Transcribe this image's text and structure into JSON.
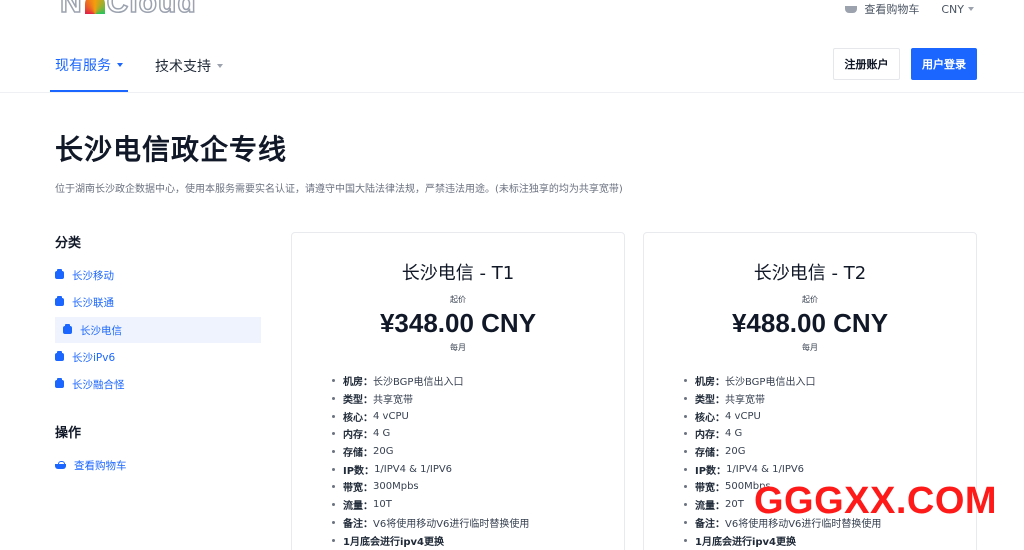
{
  "header": {
    "logo_text_left": "N",
    "logo_text_right": "Cloud",
    "cart_label": "查看购物车",
    "currency": "CNY",
    "nav": [
      {
        "label": "现有服务",
        "active": true
      },
      {
        "label": "技术支持",
        "active": false
      }
    ],
    "register_label": "注册账户",
    "login_label": "用户登录"
  },
  "page": {
    "title": "长沙电信政企专线",
    "description": "位于湖南长沙政企数据中心，使用本服务需要实名认证，请遵守中国大陆法律法规，严禁违法用途。(未标注独享的均为共享宽带)"
  },
  "sidebar": {
    "categories_heading": "分类",
    "categories": [
      {
        "label": "长沙移动",
        "active": false
      },
      {
        "label": "长沙联通",
        "active": false
      },
      {
        "label": "长沙电信",
        "active": true
      },
      {
        "label": "长沙iPv6",
        "active": false
      },
      {
        "label": "长沙融合怪",
        "active": false
      }
    ],
    "actions_heading": "操作",
    "actions": [
      {
        "label": "查看购物车"
      }
    ]
  },
  "products": [
    {
      "title": "长沙电信 - T1",
      "from_label": "起价",
      "price": "¥348.00 CNY",
      "cycle": "每月",
      "specs": [
        {
          "key": "机房",
          "value": "长沙BGP电信出入口"
        },
        {
          "key": "类型",
          "value": "共享宽带"
        },
        {
          "key": "核心",
          "value": "4 vCPU"
        },
        {
          "key": "内存",
          "value": "4 G"
        },
        {
          "key": "存储",
          "value": "20G"
        },
        {
          "key": "IP数",
          "value": "1/IPV4 & 1/IPV6"
        },
        {
          "key": "带宽",
          "value": "300Mpbs"
        },
        {
          "key": "流量",
          "value": "10T"
        },
        {
          "key": "备注",
          "value": "V6将使用移动V6进行临时替换使用"
        },
        {
          "key": "",
          "value": "1月底会进行ipv4更换"
        }
      ]
    },
    {
      "title": "长沙电信 - T2",
      "from_label": "起价",
      "price": "¥488.00 CNY",
      "cycle": "每月",
      "specs": [
        {
          "key": "机房",
          "value": "长沙BGP电信出入口"
        },
        {
          "key": "类型",
          "value": "共享宽带"
        },
        {
          "key": "核心",
          "value": "4 vCPU"
        },
        {
          "key": "内存",
          "value": "4 G"
        },
        {
          "key": "存储",
          "value": "20G"
        },
        {
          "key": "IP数",
          "value": "1/IPV4 & 1/IPV6"
        },
        {
          "key": "带宽",
          "value": "500Mbps"
        },
        {
          "key": "流量",
          "value": "20T"
        },
        {
          "key": "备注",
          "value": "V6将使用移动V6进行临时替换使用"
        },
        {
          "key": "",
          "value": "1月底会进行ipv4更换"
        }
      ]
    }
  ],
  "colors": {
    "accent": "#1a66ff",
    "watermark": "#ff1a1a"
  },
  "watermark": "GGGXX.COM"
}
